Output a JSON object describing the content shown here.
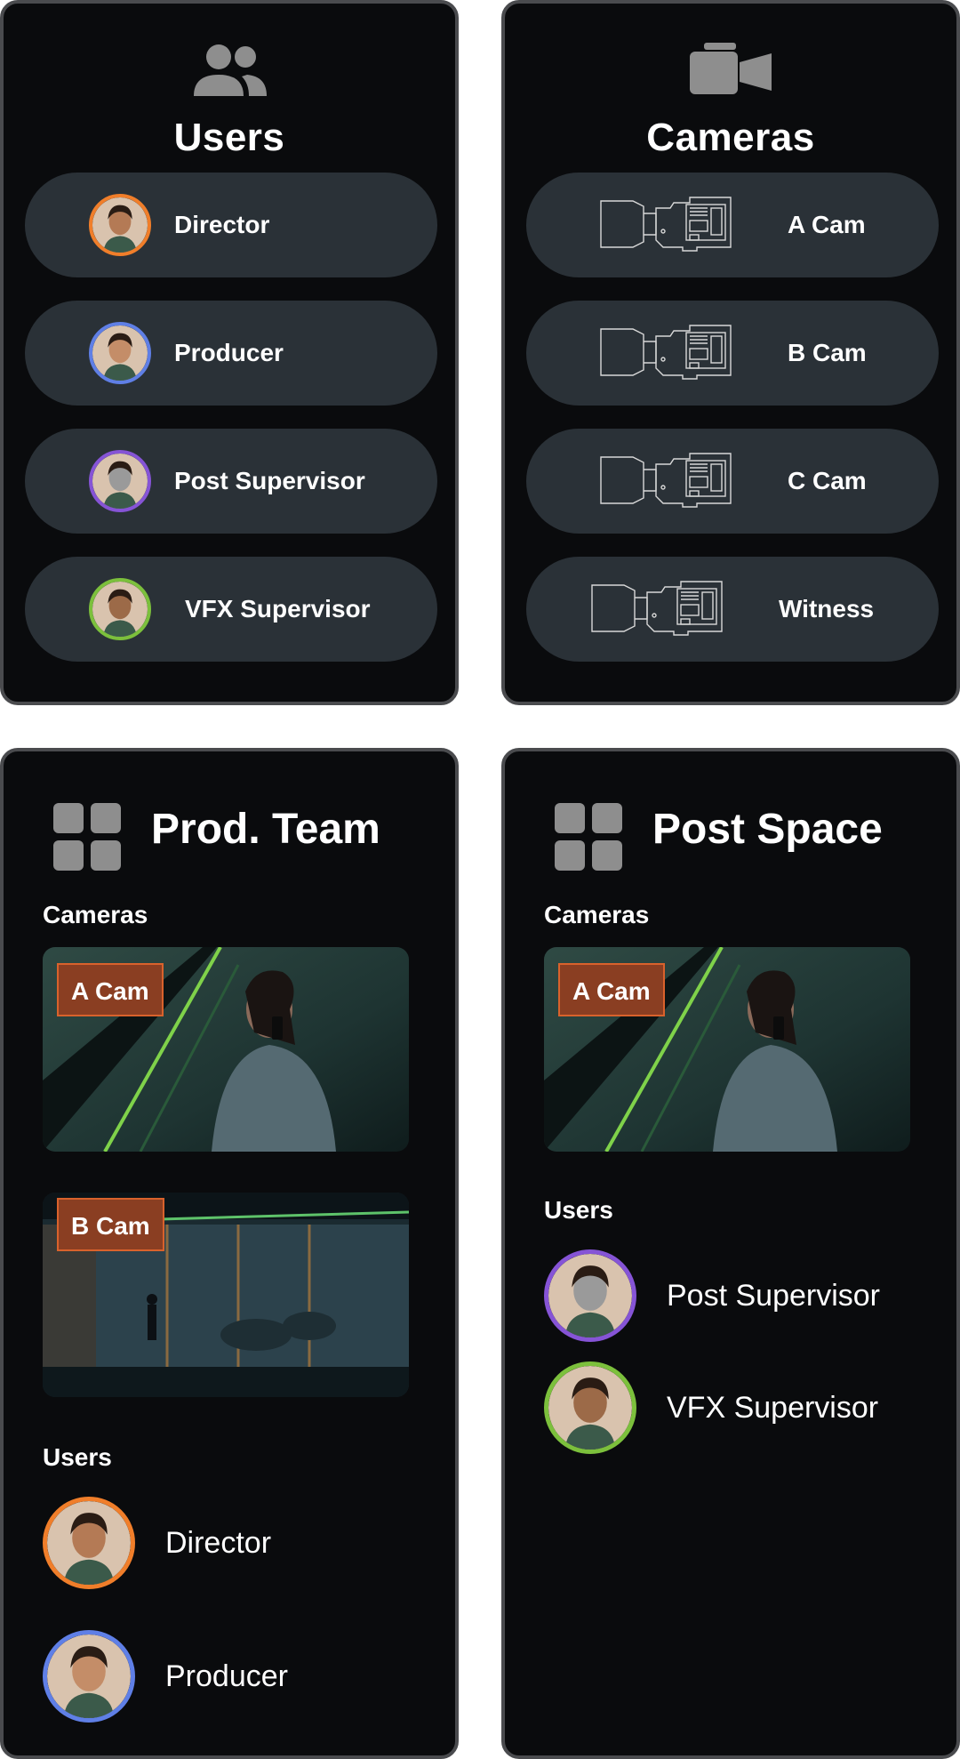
{
  "users_panel": {
    "title": "Users",
    "icon": "users-icon",
    "items": [
      {
        "label": "Director",
        "ring": "#f07e2a",
        "skin": "#b47a55"
      },
      {
        "label": "Producer",
        "ring": "#5f7fe6",
        "skin": "#c48d68"
      },
      {
        "label": "Post Supervisor",
        "ring": "#8654d6",
        "skin": "#9a9a9a"
      },
      {
        "label": "VFX Supervisor",
        "ring": "#7cc03c",
        "skin": "#9c6a48"
      }
    ]
  },
  "cameras_panel": {
    "title": "Cameras",
    "icon": "video-camera-icon",
    "items": [
      {
        "label": "A Cam"
      },
      {
        "label": "B Cam"
      },
      {
        "label": "C Cam"
      },
      {
        "label": "Witness"
      }
    ]
  },
  "prod_team": {
    "title": "Prod. Team",
    "icon": "grid-icon",
    "cameras_label": "Cameras",
    "feeds": [
      {
        "tag": "A Cam"
      },
      {
        "tag": "B Cam"
      }
    ],
    "users_label": "Users",
    "users": [
      {
        "label": "Director"
      },
      {
        "label": "Producer"
      }
    ]
  },
  "post_space": {
    "title": "Post Space",
    "icon": "grid-icon",
    "cameras_label": "Cameras",
    "feeds": [
      {
        "tag": "A Cam"
      }
    ],
    "users_label": "Users",
    "users": [
      {
        "label": "Post Supervisor"
      },
      {
        "label": "VFX Supervisor"
      }
    ]
  },
  "colors": {
    "panel_bg": "#0a0b0d",
    "panel_border": "#4a4b4e",
    "pill_bg": "#2a3137",
    "tag_bg": "#8a3e22",
    "tag_border": "#d9622c",
    "icon_gray": "#8e8e8e"
  }
}
